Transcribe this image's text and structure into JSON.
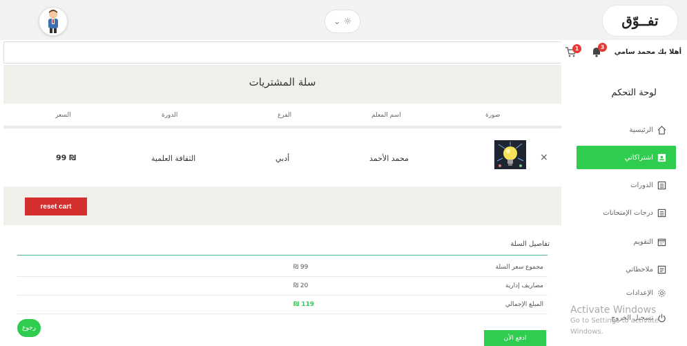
{
  "header": {
    "logo": "تفــوّق",
    "greeting": "أهلا بك محمد سامي",
    "notifications_count": "3",
    "cart_count": "1"
  },
  "sidebar": {
    "title": "لوحة التحكم",
    "items": [
      {
        "label": "الرئيسية",
        "icon": "home-icon",
        "active": false
      },
      {
        "label": "اشتراكاتي",
        "icon": "subscriptions-icon",
        "active": true
      },
      {
        "label": "الدورات",
        "icon": "courses-icon",
        "active": false
      },
      {
        "label": "درجات الإمتحانات",
        "icon": "grades-icon",
        "active": false
      },
      {
        "label": "التقويم",
        "icon": "calendar-icon",
        "active": false
      },
      {
        "label": "ملاحظاتي",
        "icon": "notes-icon",
        "active": false
      },
      {
        "label": "الإعدادات",
        "icon": "gear-icon",
        "active": false
      },
      {
        "label": "تسجيل الخروج",
        "icon": "logout-icon",
        "active": false
      }
    ]
  },
  "cart": {
    "title": "سلة المشتريات",
    "columns": [
      "صورة",
      "اسم المعلم",
      "الفرع",
      "الدورة",
      "السعر"
    ],
    "rows": [
      {
        "teacher": "محمد الأحمد",
        "branch": "أدبي",
        "course": "الثقافة العلمية",
        "price": "99 ₪"
      }
    ],
    "reset_label": "reset cart"
  },
  "details": {
    "title": "تفاصيل السلة",
    "rows": [
      {
        "label": "مجموع سعر السلة",
        "value": "₪ 99"
      },
      {
        "label": "مصاريف إدارية",
        "value": "₪ 20"
      },
      {
        "label": "المبلغ الإجمالي",
        "value": "₪ 119"
      }
    ],
    "pay_label": "ادفع الأن"
  },
  "back_label": "رجوع",
  "watermark": {
    "line1": "Activate Windows",
    "line2": "Go to Settings to activate Windows."
  },
  "colors": {
    "accent": "#2ecc4f",
    "danger": "#d32f2f",
    "hero": "#f0efea"
  }
}
